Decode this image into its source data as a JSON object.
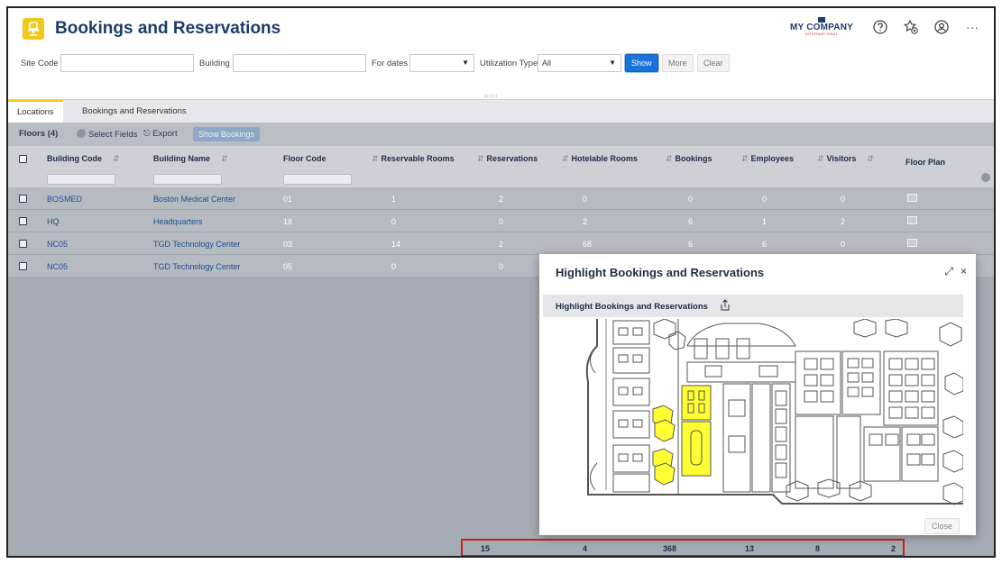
{
  "header": {
    "title": "Bookings and Reservations",
    "logo_main": "MY COMPANY",
    "logo_sub": "INTERNATIONAL",
    "icons": [
      "help-icon",
      "favorites-icon",
      "user-icon",
      "more-icon"
    ],
    "more_glyph": "···"
  },
  "filters": {
    "site_code_label": "Site Code",
    "site_code_value": "",
    "building_label": "Building",
    "building_value": "",
    "for_dates_label": "For dates",
    "for_dates_value": "",
    "utilization_label": "Utilization Type",
    "utilization_value": "All",
    "show_label": "Show",
    "more_label": "More",
    "clear_label": "Clear"
  },
  "tabs": [
    {
      "label": "Locations",
      "active": true
    },
    {
      "label": "Bookings and Reservations",
      "active": false
    }
  ],
  "toolbar": {
    "floors_label": "Floors (4)",
    "select_fields_label": "Select Fields",
    "export_label": "Export",
    "show_bookings_label": "Show Bookings"
  },
  "columns": [
    "Building Code",
    "Building Name",
    "Floor Code",
    "Reservable Rooms",
    "Reservations",
    "Hotelable Rooms",
    "Bookings",
    "Employees",
    "Visitors",
    "Floor Plan"
  ],
  "rows": [
    {
      "building_code": "BOSMED",
      "building_name": "Boston Medical Center",
      "floor_code": "01",
      "reservable_rooms": "1",
      "reservations": "2",
      "hotelable_rooms": "0",
      "bookings": "0",
      "employees": "0",
      "visitors": "0"
    },
    {
      "building_code": "HQ",
      "building_name": "Headquarters",
      "floor_code": "18",
      "reservable_rooms": "0",
      "reservations": "0",
      "hotelable_rooms": "2",
      "bookings": "6",
      "employees": "1",
      "visitors": "2"
    },
    {
      "building_code": "NC05",
      "building_name": "TGD Technology Center",
      "floor_code": "03",
      "reservable_rooms": "14",
      "reservations": "2",
      "hotelable_rooms": "68",
      "bookings": "6",
      "employees": "6",
      "visitors": "0"
    },
    {
      "building_code": "NC05",
      "building_name": "TGD Technology Center",
      "floor_code": "05",
      "reservable_rooms": "0",
      "reservations": "0",
      "hotelable_rooms": "",
      "bookings": "",
      "employees": "",
      "visitors": ""
    }
  ],
  "totals": {
    "reservable_rooms": "15",
    "reservations": "4",
    "hotelable_rooms": "368",
    "bookings": "13",
    "employees": "8",
    "visitors": "2"
  },
  "dialog": {
    "title": "Highlight Bookings and Reservations",
    "subtitle": "Highlight Bookings and Reservations",
    "close_label": "Close",
    "expand_glyph": "⤢",
    "close_glyph": "×"
  },
  "colors": {
    "accent": "#f2c91a",
    "title_blue": "#1d3c6b",
    "show_button": "#1a73d9",
    "totals_border": "#d01e1e",
    "highlight_yellow": "#ffff33"
  }
}
